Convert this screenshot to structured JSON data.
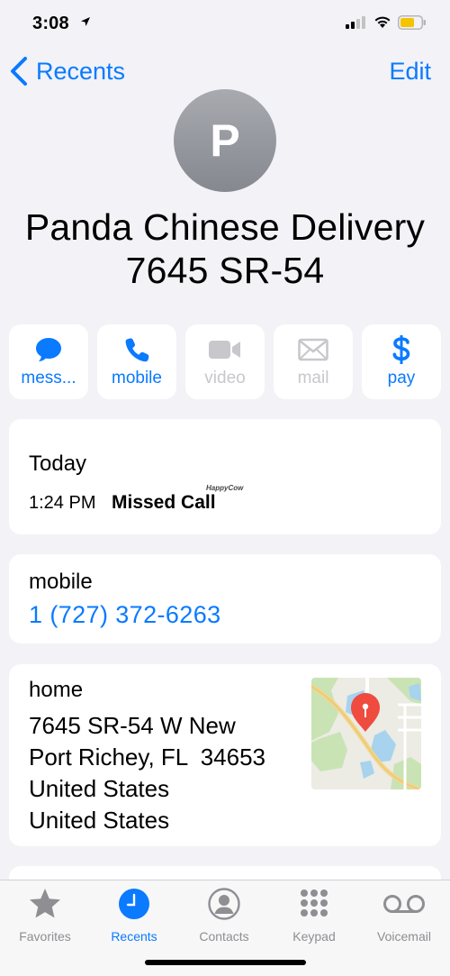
{
  "status_bar": {
    "time": "3:08",
    "battery_color": "#f5c400"
  },
  "nav": {
    "back_label": "Recents",
    "edit_label": "Edit"
  },
  "contact": {
    "initial": "P",
    "name_line1": "Panda Chinese Delivery",
    "name_line2": "7645 SR-54"
  },
  "actions": [
    {
      "label": "mess...",
      "icon": "message-icon",
      "enabled": true
    },
    {
      "label": "mobile",
      "icon": "phone-icon",
      "enabled": true
    },
    {
      "label": "video",
      "icon": "video-icon",
      "enabled": false
    },
    {
      "label": "mail",
      "icon": "mail-icon",
      "enabled": false
    },
    {
      "label": "pay",
      "icon": "dollar-icon",
      "enabled": true
    }
  ],
  "call_history": {
    "title": "Today",
    "time": "1:24 PM",
    "status": "Missed Call",
    "watermark": "HappyCow"
  },
  "phone": {
    "label": "mobile",
    "number": "1 (727) 372-6263"
  },
  "address": {
    "label": "home",
    "lines": [
      "7645 SR-54 W New",
      "Port Richey, FL  34653",
      "United States",
      "United States"
    ]
  },
  "tabs": [
    {
      "label": "Favorites",
      "icon": "star-icon",
      "active": false
    },
    {
      "label": "Recents",
      "icon": "clock-icon",
      "active": true
    },
    {
      "label": "Contacts",
      "icon": "person-circle-icon",
      "active": false
    },
    {
      "label": "Keypad",
      "icon": "keypad-icon",
      "active": false
    },
    {
      "label": "Voicemail",
      "icon": "voicemail-icon",
      "active": false
    }
  ],
  "colors": {
    "accent": "#0a7aff",
    "disabled": "#c7c7cc",
    "background": "#f2f2f7",
    "pin": "#ef4b3f"
  }
}
